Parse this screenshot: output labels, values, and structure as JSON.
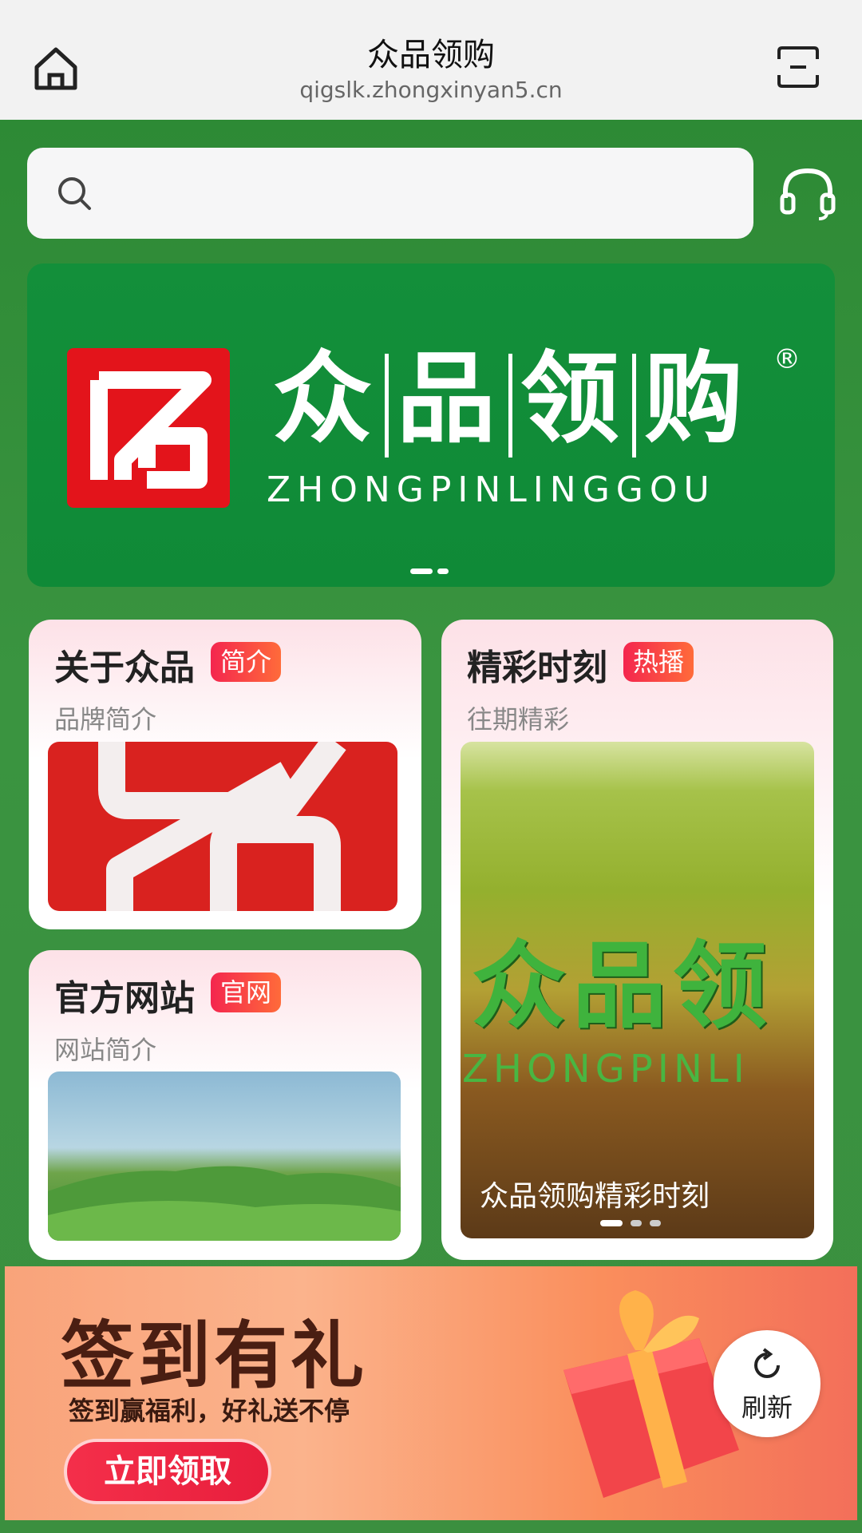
{
  "topbar": {
    "title": "众品领购",
    "url": "qigslk.zhongxinyan5.cn"
  },
  "banner": {
    "brand_cn_chars": [
      "众",
      "品",
      "领",
      "购"
    ],
    "registered": "®",
    "brand_en": "ZHONGPINLINGGOU"
  },
  "cards": {
    "about": {
      "title": "关于众品",
      "tag": "简介",
      "subtitle": "品牌简介"
    },
    "website": {
      "title": "官方网站",
      "tag": "官网",
      "subtitle": "网站简介"
    },
    "moments": {
      "title": "精彩时刻",
      "tag": "热播",
      "subtitle": "往期精彩",
      "caption": "众品领购精彩时刻",
      "image_text_cn": "众品领",
      "image_text_en": "ZHONGPINLI"
    }
  },
  "promo": {
    "title": "签到有礼",
    "subtitle": "签到赢福利，好礼送不停",
    "button": "立即领取"
  },
  "refresh": {
    "label": "刷新"
  },
  "colors": {
    "topbar_bg": "#f2f2f2",
    "page_green": "#3a8f3e",
    "banner_green": "#138f3a",
    "logo_red": "#e3141b",
    "tag_gradient_start": "#f4264e",
    "tag_gradient_end": "#ff6b3a"
  }
}
